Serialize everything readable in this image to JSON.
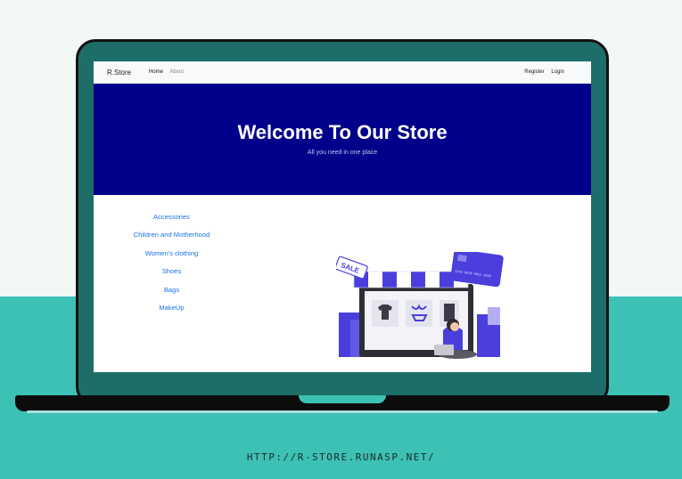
{
  "navbar": {
    "brand": "R.Store",
    "left_links": [
      "Home",
      "About"
    ],
    "right_links": [
      "Register",
      "Login"
    ]
  },
  "hero": {
    "title": "Welcome To Our Store",
    "subtitle": "All you need in one place"
  },
  "categories": [
    "Accessories",
    "Children and Motherhood",
    "Women's clothing",
    "Shoes",
    "Bags",
    "MakeUp"
  ],
  "illustration": {
    "sale_tag": "SALE",
    "card_number": "1234 5678 9012 3456"
  },
  "footer": {
    "url": "HTTP://R-STORE.RUNASP.NET/"
  },
  "colors": {
    "hero_bg": "#00008b",
    "teal_band": "#3dc1b4",
    "bezel": "#1d6e68",
    "link": "#1a73e8",
    "accent": "#4a3fdd"
  }
}
